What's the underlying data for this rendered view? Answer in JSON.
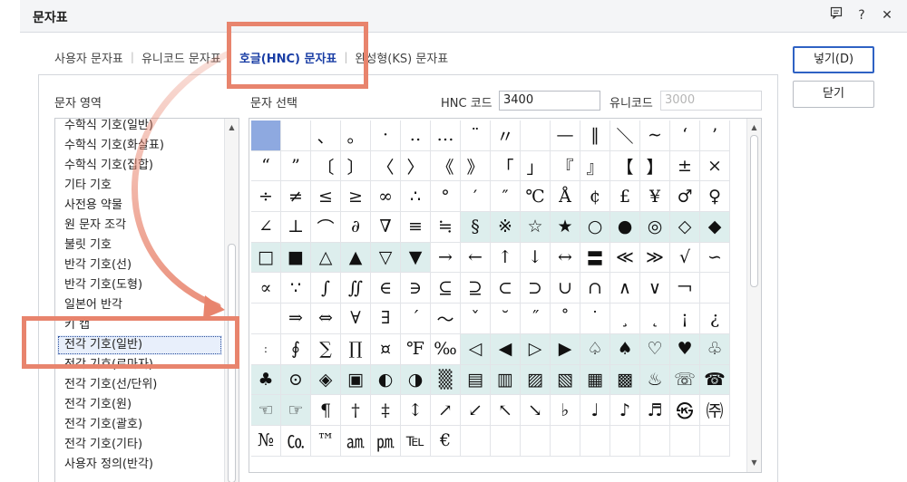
{
  "window": {
    "title": "문자표"
  },
  "tabs": [
    {
      "label": "사용자 문자표",
      "active": false
    },
    {
      "label": "유니코드 문자표",
      "active": false
    },
    {
      "label": "호글(HNC) 문자표",
      "active": true
    },
    {
      "label": "완성형(KS) 문자표",
      "active": false
    }
  ],
  "buttons": {
    "insert": "넣기(D)",
    "close": "닫기"
  },
  "area": {
    "label": "문자 영역",
    "items": [
      "수학식 기호(일반)",
      "수학식 기호(화살표)",
      "수학식 기호(집합)",
      "기타 기호",
      "사전용 약물",
      "원 문자 조각",
      "불릿 기호",
      "반각 기호(선)",
      "반각 기호(도형)",
      "일본어 반각",
      "키 캡",
      "전각 기호(일반)",
      "전각 기호(로마자)",
      "전각 기호(선/단위)",
      "전각 기호(원)",
      "전각 기호(괄호)",
      "전각 기호(기타)",
      "사용자 정의(반각)"
    ],
    "selected_index": 11
  },
  "chars": {
    "label": "문자 선택",
    "hnc_label": "HNC 코드",
    "hnc_value": "3400",
    "unicode_label": "유니코드",
    "unicode_value": "3000",
    "rows": [
      [
        "",
        "",
        "、",
        "。",
        "·",
        "‥",
        "…",
        "¨",
        "〃",
        "",
        "—",
        "‖",
        "＼",
        "∼",
        "‘",
        "’"
      ],
      [
        "“",
        "”",
        "〔",
        "〕",
        "〈",
        "〉",
        "《",
        "》",
        "「",
        "」",
        "『",
        "』",
        "【",
        "】",
        "±",
        "×"
      ],
      [
        "÷",
        "≠",
        "≤",
        "≥",
        "∞",
        "∴",
        "°",
        "′",
        "″",
        "℃",
        "Å",
        "¢",
        "£",
        "¥",
        "♂",
        "♀"
      ],
      [
        "∠",
        "⊥",
        "⌒",
        "∂",
        "∇",
        "≡",
        "≒",
        "§",
        "※",
        "☆",
        "★",
        "○",
        "●",
        "◎",
        "◇",
        "◆"
      ],
      [
        "□",
        "■",
        "△",
        "▲",
        "▽",
        "▼",
        "→",
        "←",
        "↑",
        "↓",
        "↔",
        "〓",
        "≪",
        "≫",
        "√",
        "∽"
      ],
      [
        "∝",
        "∵",
        "∫",
        "∬",
        "∈",
        "∋",
        "⊆",
        "⊇",
        "⊂",
        "⊃",
        "∪",
        "∩",
        "∧",
        "∨",
        "￢",
        ""
      ],
      [
        "",
        "⇒",
        "⇔",
        "∀",
        "∃",
        "´",
        "～",
        "ˇ",
        "˘",
        "˝",
        "˚",
        "˙",
        "¸",
        "˛",
        "¡",
        "¿"
      ],
      [
        "ː",
        "∮",
        "∑",
        "∏",
        "¤",
        "℉",
        "‰",
        "◁",
        "◀",
        "▷",
        "▶",
        "♤",
        "♠",
        "♡",
        "♥",
        "♧"
      ],
      [
        "♣",
        "⊙",
        "◈",
        "▣",
        "◐",
        "◑",
        "▒",
        "▤",
        "▥",
        "▨",
        "▧",
        "▦",
        "▩",
        "♨",
        "☏",
        "☎"
      ],
      [
        "☜",
        "☞",
        "¶",
        "†",
        "‡",
        "↕",
        "↗",
        "↙",
        "↖",
        "↘",
        "♭",
        "♩",
        "♪",
        "♬",
        "㉿",
        "㈜"
      ],
      [
        "№",
        "㏇",
        "™",
        "㏂",
        "㏘",
        "℡",
        "€",
        "",
        "",
        "",
        "",
        "",
        "",
        "",
        "",
        ""
      ]
    ]
  },
  "colors": {
    "accent": "#2f62c4",
    "tab_active": "#1a3ea5",
    "selected_cell": "#8ea9e0",
    "shaded_cell": "#ddeeed",
    "annotation": "#e8846d"
  }
}
